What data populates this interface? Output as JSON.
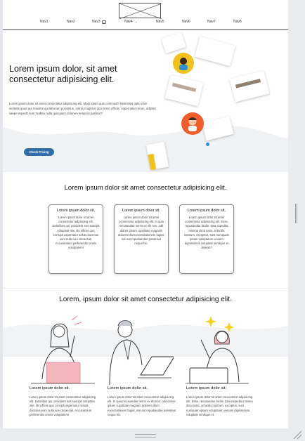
{
  "header": {
    "logo_alt": "logo placeholder",
    "nav": [
      {
        "label": "Nav1",
        "dropdown": false
      },
      {
        "label": "Nav2",
        "dropdown": false
      },
      {
        "label": "Nav3",
        "dropdown": true
      },
      {
        "label": "Nav4",
        "dropdown": true
      },
      {
        "label": "Nav5",
        "dropdown": false
      },
      {
        "label": "Nav6",
        "dropdown": false
      },
      {
        "label": "Nav7",
        "dropdown": false
      },
      {
        "label": "Nav8",
        "dropdown": false
      }
    ]
  },
  "hero": {
    "title": "Lorem ipsum dolor, sit amet consectetur adipisicing elit.",
    "body": "Lorem ipsum dolor sit amet consectetur adipisicing elit. Modi totam quis commodi? Molestias optio nam veritatis quod aut maxime qui laborum possimus, omnis magni et quo nemo officiis. Aspernatur rerum, adipisci saepe impedit eum mollitia nulla quisquam dolorem tempora pariatur?",
    "cta_label": "Check Pricing"
  },
  "section2": {
    "title": "Lorem ipsum dolor sit amet consectetur adipisicing elit.",
    "cards": [
      {
        "title": "Lorem ipsum dolor sit.",
        "body": "Lorem ipsum dolor sit amet consectetur adipisicing elit. Doloribus qui, provident eos suscipit voluptate iste, illo officiis quo corrupti aspernatur soluta ducimus eum nulla iure obcaecati. Accusantium perferendis omnis voluptatem!"
      },
      {
        "title": "Lorem ipsum dolor sit.",
        "body": "Lorem ipsum dolor sit amet consectetur adipisicing elit. In quia recusandae nemo ex illo non. odit dolore ipsam cupiditate magnam dolorem illum exercitationem fugiat, nisi aut repudiandae possimus neque hic."
      },
      {
        "title": "Lorem ipsum dolor sit.",
        "body": "Lorem ipsum dolor sit amet consectetur adipisicing elit. Esse, recusandae facilis. Ipsa expedita minima dicta iusto, at facilis nostrum, excepturi, sunt numquam ipsam voluptatum veniam dignissimos voluptate similique et deleniti?"
      }
    ]
  },
  "section3": {
    "title": "Lorem, ipsum dolor sit amet consectetur adipisicing elit.",
    "features": [
      {
        "title": "Lorem ipsum dolor sit.",
        "body": "Lorem ipsum dolor sit amet consectetur adipisicing elit. Doloribus qui, provident eos suscipit voluptate iste, illo officiis quo corrupti aspernatur soluta ducimus eum nulla iure obcaecati. Accusantium perferendis omnis voluptatem!"
      },
      {
        "title": "Lorem ipsum dolor sit.",
        "body": "Lorem ipsum dolor sit amet consectetur adipisicing elit. In quia recusandae nemo ex illo non. odit dolore ipsam cupiditate magnam dolorem illum exercitationem fugiat, nisi aut repudiandae possimus neque hic."
      },
      {
        "title": "Lorem ipsum dolor sit.",
        "body": "Lorem ipsum dolor sit amet consectetur adipisicing elit. Esse, recusandae facilis. Ipsa expedita minima dicta iusto, at facilis nostrum, excepturi, sunt numquam ipsam voluptatum veniam dignissimos voluptate similique et."
      }
    ]
  },
  "colors": {
    "accent": "#2f6ea8",
    "avatar_yellow": "#f2c21b",
    "avatar_orange": "#f25c2a",
    "avatar_blue": "#2d8fd6",
    "pink": "#f3b6bd"
  },
  "icons": [
    "logo-placeholder-icon",
    "chevron-down-icon",
    "user-avatar-icon",
    "resize-grip-icon"
  ]
}
